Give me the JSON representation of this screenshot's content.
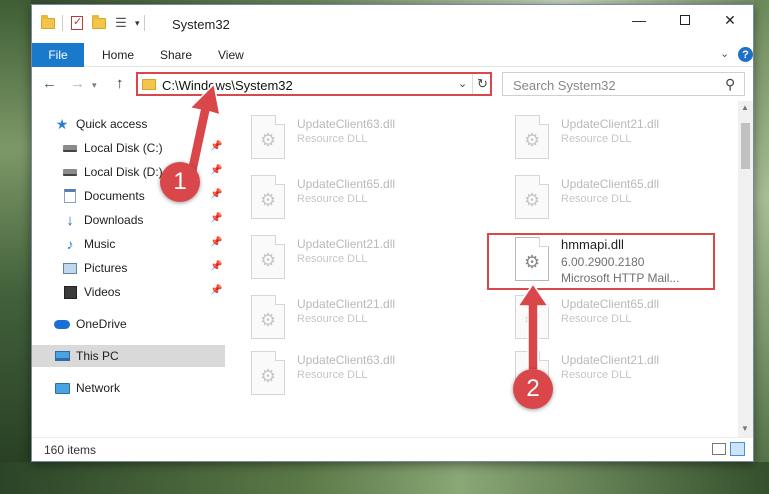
{
  "window": {
    "title": "System32",
    "controls": {
      "minimize": "—",
      "maximize": "",
      "close": "✕"
    }
  },
  "ribbon": {
    "tabs": [
      "File",
      "Home",
      "Share",
      "View"
    ],
    "expand_icon": "chevron-down-icon",
    "help_glyph": "?"
  },
  "nav": {
    "address": "C:\\Windows\\System32",
    "search_placeholder": "Search System32"
  },
  "sidebar": {
    "quick_access": "Quick access",
    "items": [
      "Local Disk (C:)",
      "Local Disk (D:)",
      "Documents",
      "Downloads",
      "Music",
      "Pictures",
      "Videos"
    ],
    "onedrive": "OneDrive",
    "this_pc": "This PC",
    "network": "Network"
  },
  "files": {
    "left_column": [
      {
        "name": "UpdateClient63.dll",
        "type": "Resource DLL"
      },
      {
        "name": "UpdateClient65.dll",
        "type": "Resource DLL"
      },
      {
        "name": "UpdateClient21.dll",
        "type": "Resource DLL"
      },
      {
        "name": "UpdateClient21.dll",
        "type": "Resource DLL"
      },
      {
        "name": "UpdateClient63.dll",
        "type": "Resource DLL"
      }
    ],
    "right_column": [
      {
        "name": "UpdateClient21.dll",
        "type": "Resource DLL"
      },
      {
        "name": "UpdateClient65.dll",
        "type": "Resource DLL"
      },
      {
        "name": "UpdateClient65.dll",
        "type": "Resource DLL"
      },
      {
        "name": "UpdateClient21.dll",
        "type": "Resource DLL"
      }
    ],
    "highlighted": {
      "name": "hmmapi.dll",
      "version": "6.00.2900.2180",
      "description": "Microsoft HTTP Mail..."
    }
  },
  "status": {
    "item_count": "160 items"
  },
  "annotations": {
    "badge1": "1",
    "badge2": "2",
    "color": "#d9474a"
  }
}
